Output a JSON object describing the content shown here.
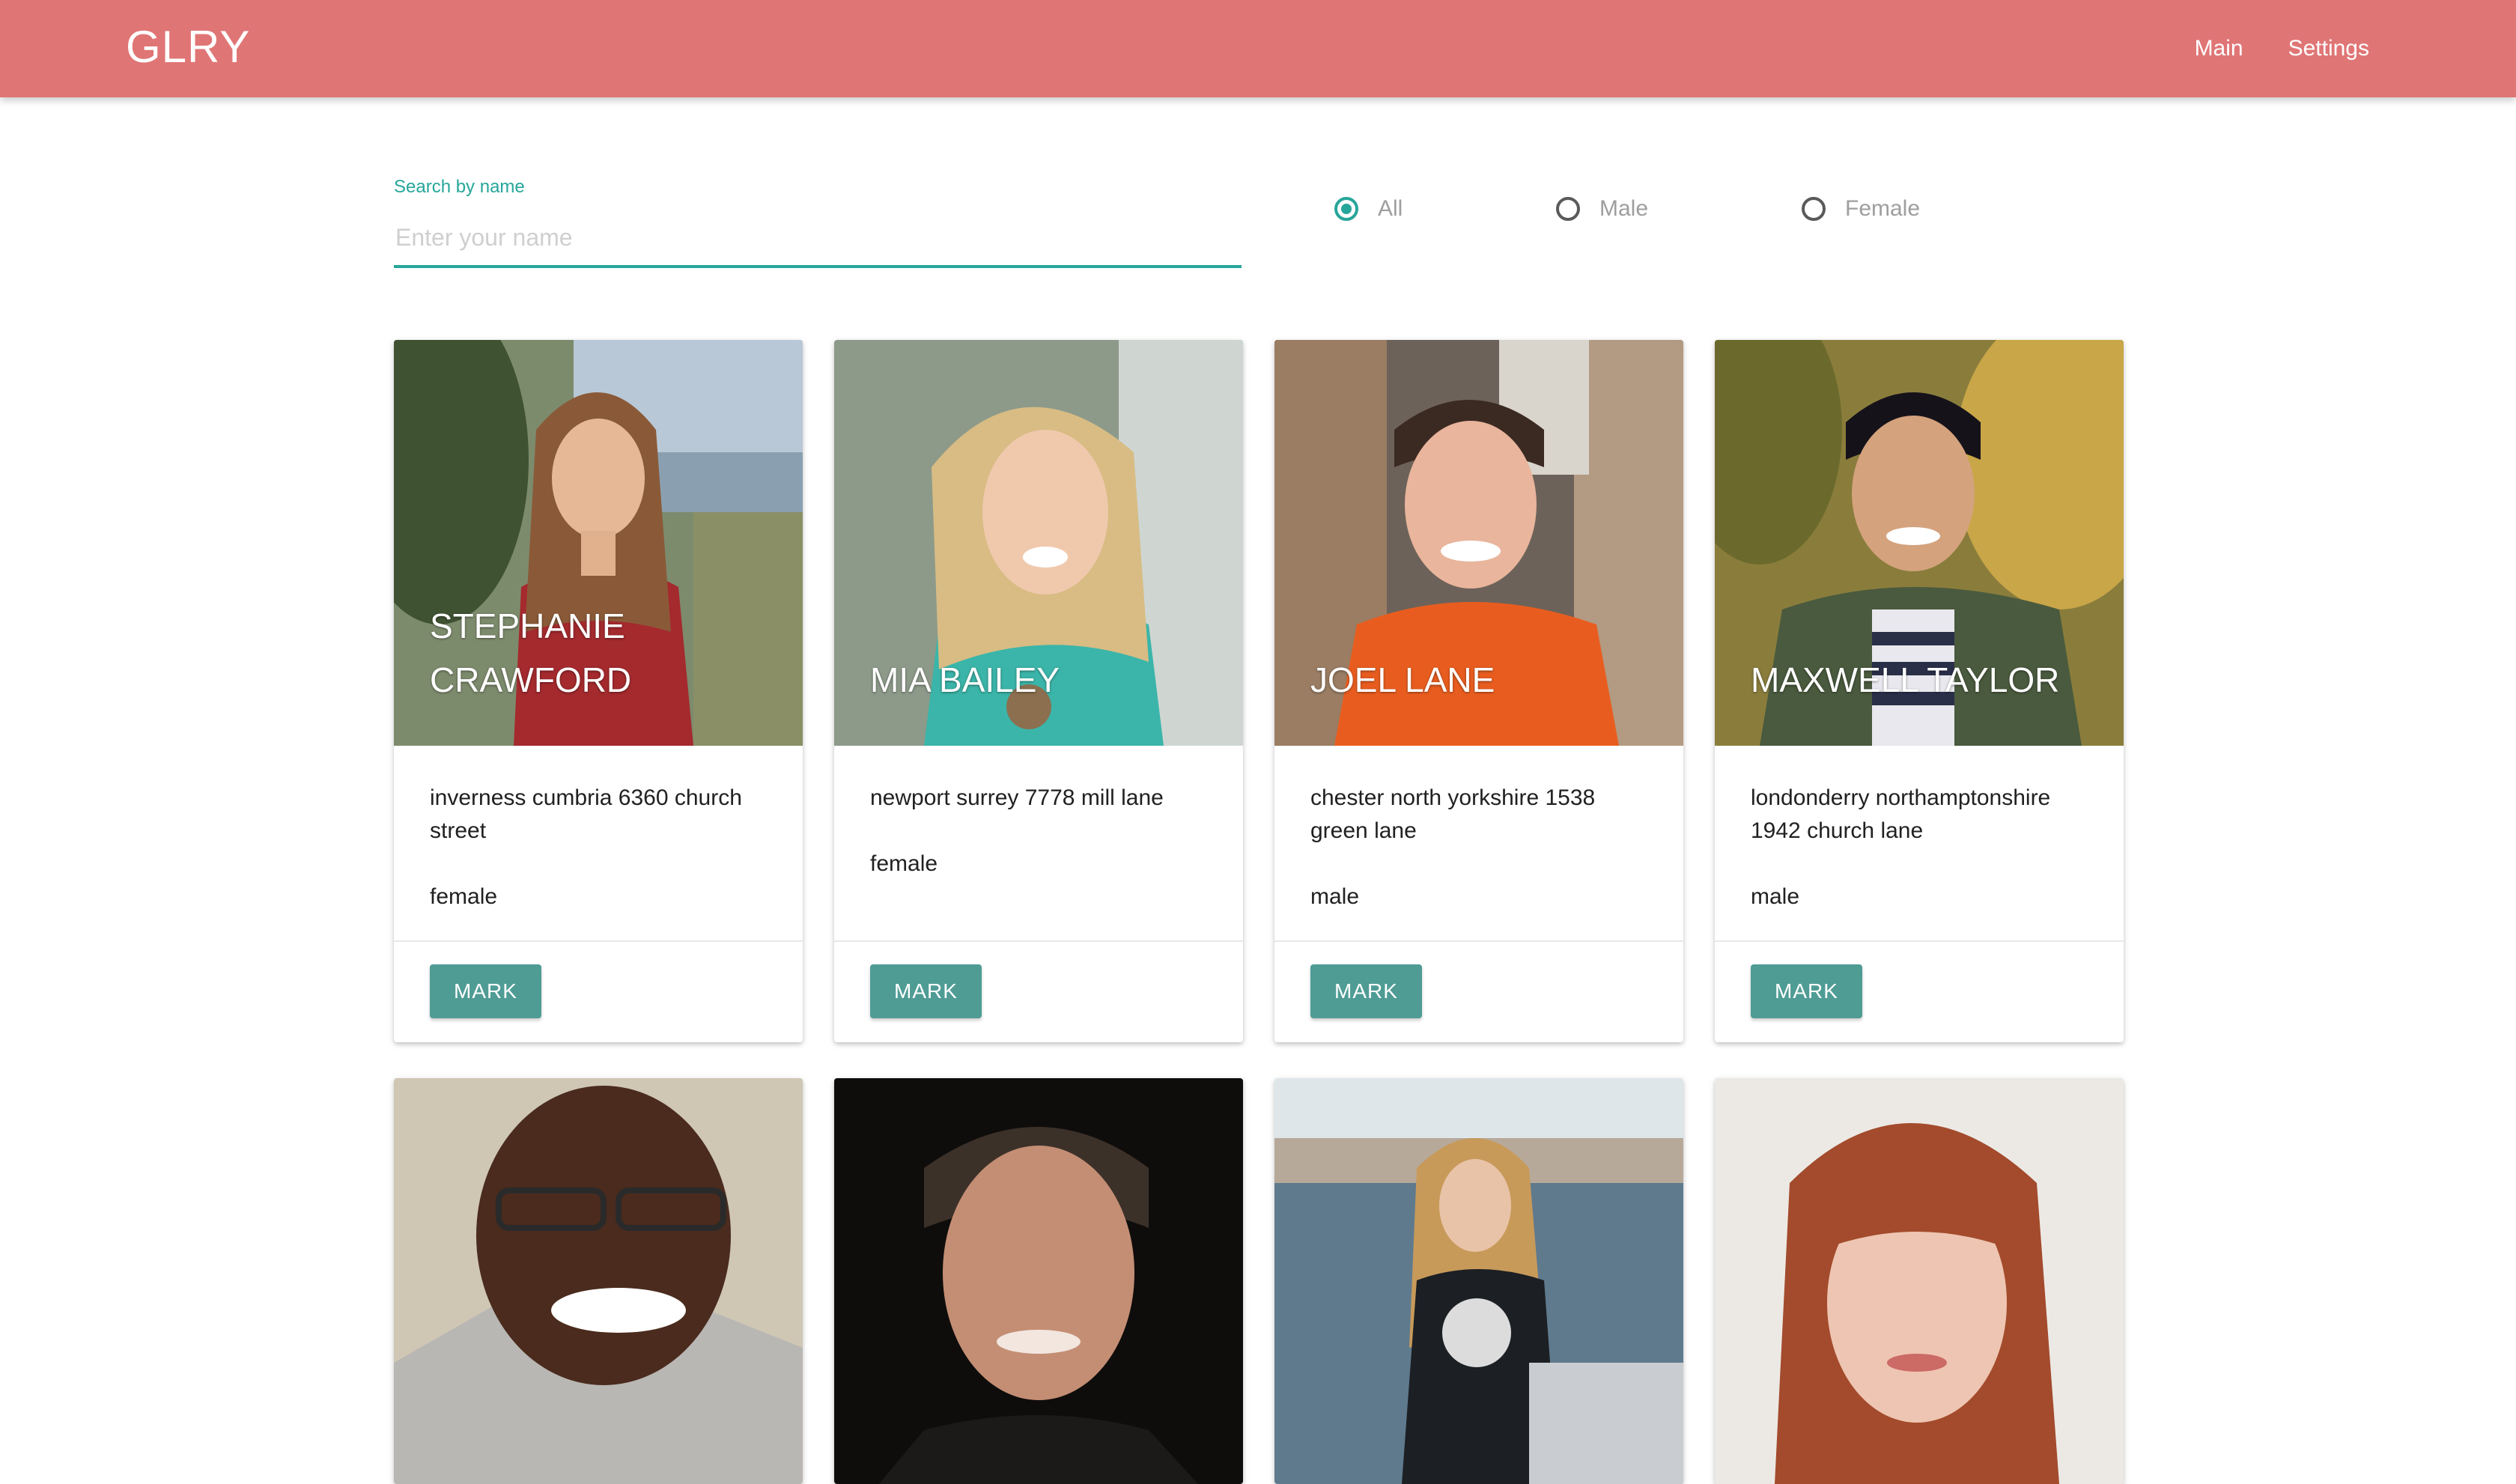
{
  "app": {
    "brand": "GLRY"
  },
  "nav": {
    "items": [
      {
        "label": "Main"
      },
      {
        "label": "Settings"
      }
    ]
  },
  "search": {
    "label": "Search by name",
    "placeholder": "Enter your name",
    "value": ""
  },
  "filters": {
    "selected": "All",
    "options": [
      {
        "label": "All"
      },
      {
        "label": "Male"
      },
      {
        "label": "Female"
      }
    ]
  },
  "colors": {
    "navbar": "#e07575",
    "accent": "#26a69a",
    "button": "#4f9c95"
  },
  "people": [
    {
      "name": "STEPHANIE CRAWFORD",
      "address": "inverness cumbria 6360 church street",
      "gender": "female",
      "action": "MARK"
    },
    {
      "name": "MIA BAILEY",
      "address": "newport surrey 7778 mill lane",
      "gender": "female",
      "action": "MARK"
    },
    {
      "name": "JOEL LANE",
      "address": "chester north yorkshire 1538 green lane",
      "gender": "male",
      "action": "MARK"
    },
    {
      "name": "MAXWELL TAYLOR",
      "address": "londonderry northamptonshire 1942 church lane",
      "gender": "male",
      "action": "MARK"
    },
    {
      "name": "",
      "address": "",
      "gender": "",
      "action": ""
    },
    {
      "name": "",
      "address": "",
      "gender": "",
      "action": ""
    },
    {
      "name": "",
      "address": "",
      "gender": "",
      "action": ""
    },
    {
      "name": "",
      "address": "",
      "gender": "",
      "action": ""
    }
  ]
}
